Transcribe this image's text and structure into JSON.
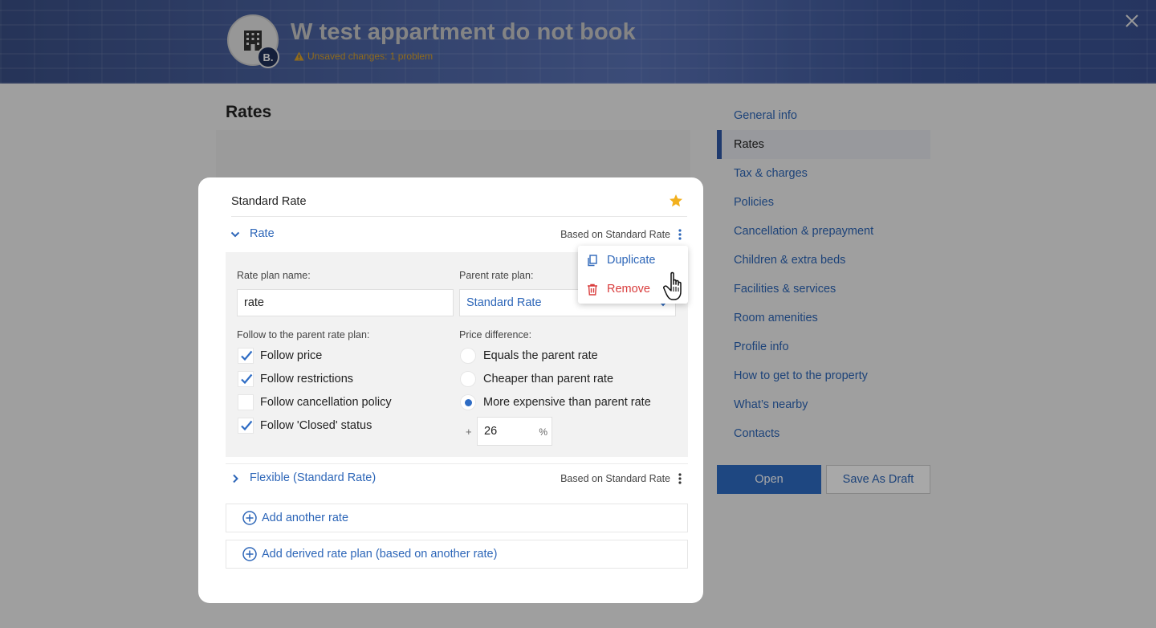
{
  "header": {
    "property_title": "W test appartment do not book",
    "avatar_badge": "B.",
    "warning": "Unsaved changes: 1 problem"
  },
  "page": {
    "title": "Rates"
  },
  "sidenav": {
    "items": [
      {
        "label": "General info",
        "active": false
      },
      {
        "label": "Rates",
        "active": true
      },
      {
        "label": "Tax & charges",
        "active": false
      },
      {
        "label": "Policies",
        "active": false
      },
      {
        "label": "Cancellation & prepayment",
        "active": false
      },
      {
        "label": "Children & extra beds",
        "active": false
      },
      {
        "label": "Facilities & services",
        "active": false
      },
      {
        "label": "Room amenities",
        "active": false
      },
      {
        "label": "Profile info",
        "active": false
      },
      {
        "label": "How to get to the property",
        "active": false
      },
      {
        "label": "What’s nearby",
        "active": false
      },
      {
        "label": "Contacts",
        "active": false
      }
    ]
  },
  "actions": {
    "open_label": "Open",
    "draft_label": "Save As Draft"
  },
  "modal": {
    "title": "Standard Rate",
    "rates": [
      {
        "name": "Rate",
        "based_on": "Based on Standard Rate",
        "expanded": true
      },
      {
        "name": "Flexible (Standard Rate)",
        "based_on": "Based on Standard Rate",
        "expanded": false
      }
    ],
    "form": {
      "rate_plan_name_label": "Rate plan name:",
      "rate_plan_name_value": "rate",
      "parent_rate_plan_label": "Parent rate plan:",
      "parent_rate_plan_value": "Standard Rate",
      "follow_label": "Follow to the parent rate plan:",
      "follow_options": [
        {
          "label": "Follow price",
          "checked": true
        },
        {
          "label": "Follow restrictions",
          "checked": true
        },
        {
          "label": "Follow cancellation policy",
          "checked": false
        },
        {
          "label": "Follow 'Closed' status",
          "checked": true
        }
      ],
      "price_diff_label": "Price difference:",
      "price_diff_options": [
        {
          "label": "Equals the parent rate",
          "selected": false
        },
        {
          "label": "Cheaper than parent rate",
          "selected": false
        },
        {
          "label": "More expensive than parent rate",
          "selected": true
        }
      ],
      "diff_sign": "+",
      "diff_value": "26",
      "diff_unit": "%"
    },
    "add_rate_label": "Add another rate",
    "add_derived_label": "Add derived rate plan (based on another rate)"
  },
  "menu": {
    "duplicate_label": "Duplicate",
    "remove_label": "Remove"
  },
  "colors": {
    "accent": "#2e6cc4",
    "link": "#2d66b8",
    "danger": "#d93c3c",
    "warning": "#d9a22b",
    "star": "#f2b01e"
  }
}
